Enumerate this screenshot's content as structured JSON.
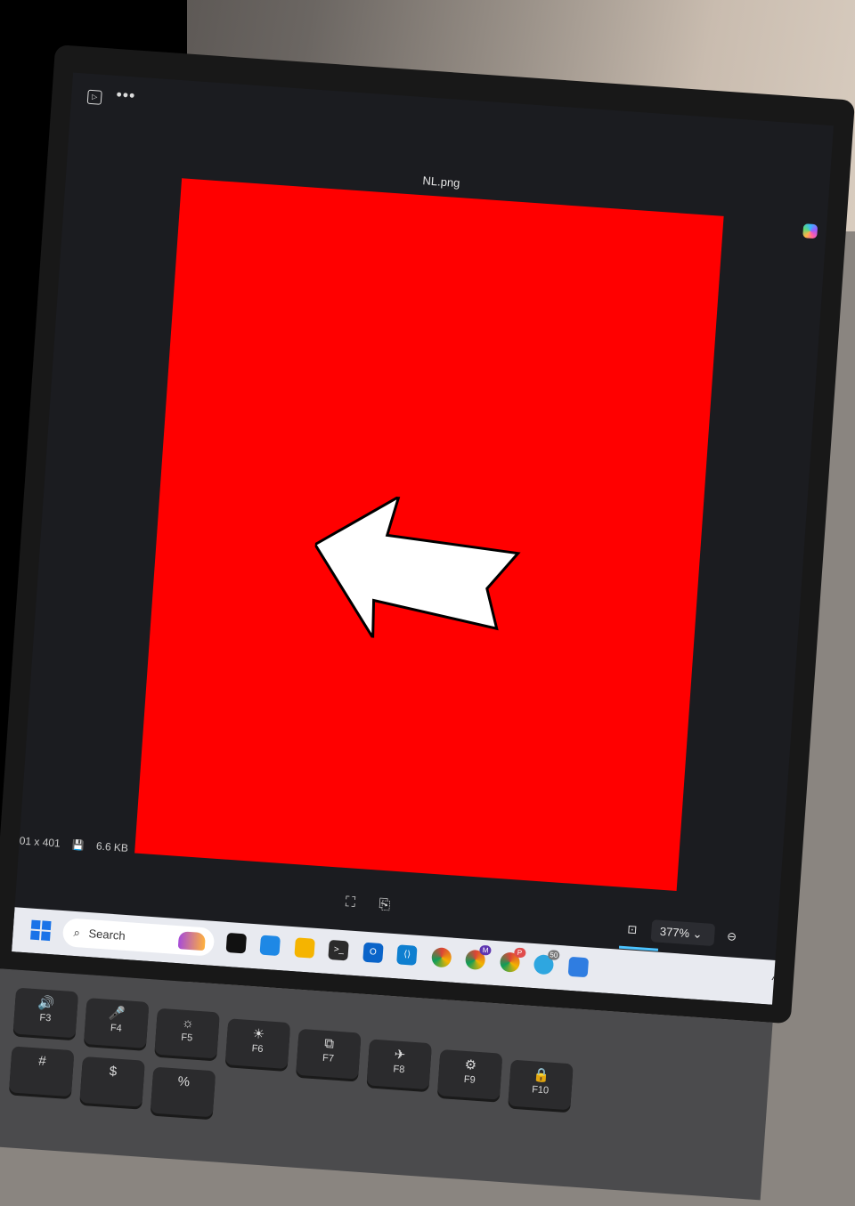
{
  "window": {
    "file_name": "NL.png",
    "icon_play": "▷",
    "icon_more": "•••"
  },
  "image": {
    "background_color": "#ff0000",
    "arrow_color": "#ffffff",
    "arrow_direction": "left"
  },
  "info": {
    "dimensions": "01 x 401",
    "file_size": "6.6 KB"
  },
  "toolbar": {
    "zoom": "377%",
    "zoom_chevron": "⌄",
    "zoom_out_icon": "⊖"
  },
  "taskbar": {
    "search_placeholder": "Search",
    "badges": [
      "M",
      "P",
      "50"
    ],
    "apps": [
      "windows-start",
      "roblox-studio",
      "file-explorer-pre",
      "file-explorer",
      "terminal",
      "outlook",
      "vs-code",
      "chrome",
      "chrome-m",
      "chrome-p",
      "telegram",
      "photos"
    ]
  },
  "keyboard": {
    "keys": [
      {
        "top": "🔊",
        "bottom": "F3"
      },
      {
        "top": "🎤",
        "bottom": "F4"
      },
      {
        "top": "☼",
        "bottom": "F5"
      },
      {
        "top": "☀",
        "bottom": "F6"
      },
      {
        "top": "⧉",
        "bottom": "F7"
      },
      {
        "top": "✈",
        "bottom": "F8"
      },
      {
        "top": "⚙",
        "bottom": "F9"
      },
      {
        "top": "🔒",
        "bottom": "F10"
      }
    ],
    "symbols": [
      "#",
      "$",
      "%"
    ]
  }
}
